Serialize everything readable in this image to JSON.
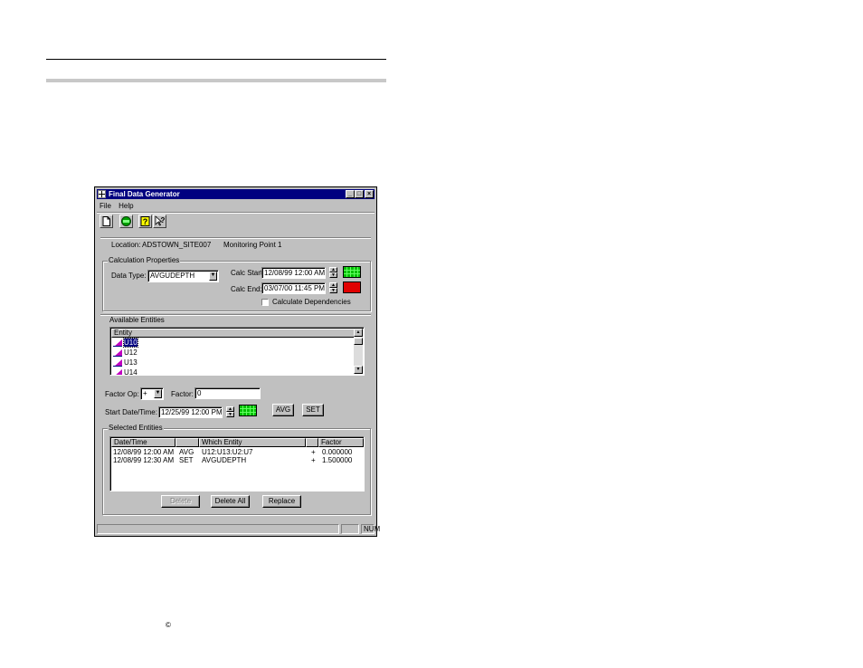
{
  "page": {
    "copyright_symbol": "©"
  },
  "window": {
    "title": "Final Data Generator",
    "controls": {
      "minimize": "_",
      "maximize": "□",
      "close": "×"
    }
  },
  "menu": {
    "file": "File",
    "help": "Help"
  },
  "toolbar": [
    {
      "name": "new-icon"
    },
    {
      "name": "run-icon"
    },
    {
      "name": "help-icon"
    },
    {
      "name": "context-help-icon"
    }
  ],
  "location": {
    "label": "Location:",
    "site": "ADSTOWN_SITE007",
    "point": "Monitoring Point 1"
  },
  "calc": {
    "group_label": "Calculation Properties",
    "data_type_label": "Data Type:",
    "data_type_value": "AVGUDEPTH",
    "start_label": "Calc Start:",
    "start_value": "12/08/99 12:00 AM",
    "end_label": "Calc End:",
    "end_value": "03/07/00 11:45 PM",
    "dependencies_label": "Calculate Dependencies"
  },
  "available": {
    "group_label": "Available Entities",
    "column": "Entity",
    "items": [
      "U10",
      "U12",
      "U13",
      "U14"
    ]
  },
  "factor": {
    "op_label": "Factor Op:",
    "op_value": "+",
    "factor_label": "Factor:",
    "factor_value": "0",
    "start_label": "Start Date/Time:",
    "start_value": "12/25/99 12:00 PM",
    "avg_button": "AVG",
    "set_button": "SET"
  },
  "selected": {
    "group_label": "Selected Entities",
    "columns": [
      "Date/Time",
      "",
      "Which Entity",
      "",
      "Factor"
    ],
    "rows": [
      {
        "date": "12/08/99 12:00 AM",
        "op": "AVG",
        "entity": "U12:U13:U2:U7",
        "sign": "+",
        "factor": "0.000000"
      },
      {
        "date": "12/08/99 12:30 AM",
        "op": "SET",
        "entity": "AVGUDEPTH",
        "sign": "+",
        "factor": "1.500000"
      }
    ],
    "delete_button": "Delete",
    "delete_all_button": "Delete All",
    "replace_button": "Replace"
  },
  "status": {
    "num": "NUM"
  },
  "colors": {
    "titlebar": "#000080",
    "face": "#c0c0c0",
    "calendar_start": "#00c000",
    "calendar_end": "#e00000"
  }
}
